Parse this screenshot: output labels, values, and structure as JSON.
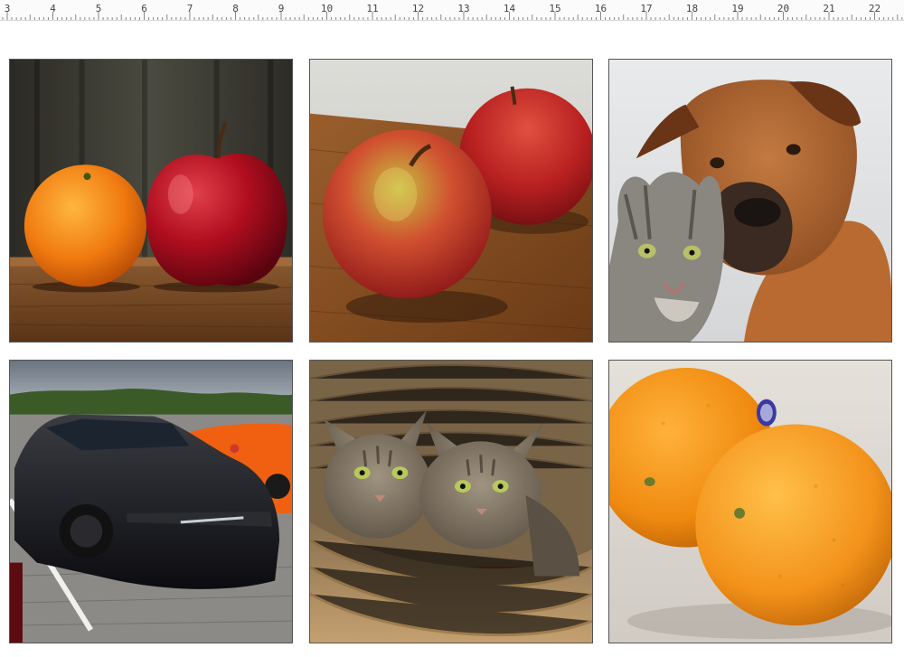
{
  "ruler": {
    "ticks": [
      "3",
      "4",
      "5",
      "6",
      "7",
      "8",
      "9",
      "10",
      "11",
      "12",
      "13",
      "14",
      "15",
      "16",
      "17",
      "18",
      "19",
      "20",
      "21",
      "22"
    ]
  },
  "tiles": [
    {
      "name": "orange-and-apple-image",
      "subject": "orange and red apple on wooden table"
    },
    {
      "name": "two-apples-image",
      "subject": "two red apples on wooden board"
    },
    {
      "name": "dog-and-cat-image",
      "subject": "boxer dog cuddling tabby cat"
    },
    {
      "name": "black-sports-car-image",
      "subject": "black sports car in parking lot"
    },
    {
      "name": "two-kittens-basket-image",
      "subject": "two tabby cats in wicker basket"
    },
    {
      "name": "two-oranges-image",
      "subject": "two oranges with sticker"
    }
  ],
  "colors": {
    "tile_border": "#555555",
    "ruler_bg": "#fbfbfb"
  }
}
